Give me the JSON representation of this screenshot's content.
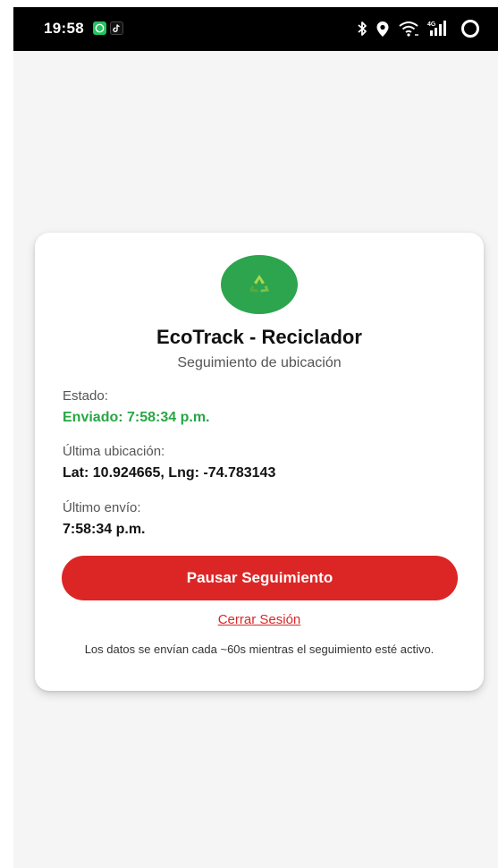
{
  "status_bar": {
    "time": "19:58",
    "network": "4G"
  },
  "app": {
    "title": "EcoTrack - Reciclador",
    "subtitle": "Seguimiento de ubicación",
    "logo_icon": "recycle-icon",
    "accent_color": "#2da44e",
    "danger_color": "#dc2626"
  },
  "status": {
    "label": "Estado:",
    "value": "Enviado: 7:58:34 p.m."
  },
  "last_location": {
    "label": "Última ubicación:",
    "value": "Lat: 10.924665, Lng: -74.783143"
  },
  "last_send": {
    "label": "Último envío:",
    "value": "7:58:34 p.m."
  },
  "actions": {
    "pause_label": "Pausar Seguimiento",
    "logout_label": "Cerrar Sesión"
  },
  "footer": {
    "note": "Los datos se envían cada ~60s mientras el seguimiento esté activo."
  }
}
